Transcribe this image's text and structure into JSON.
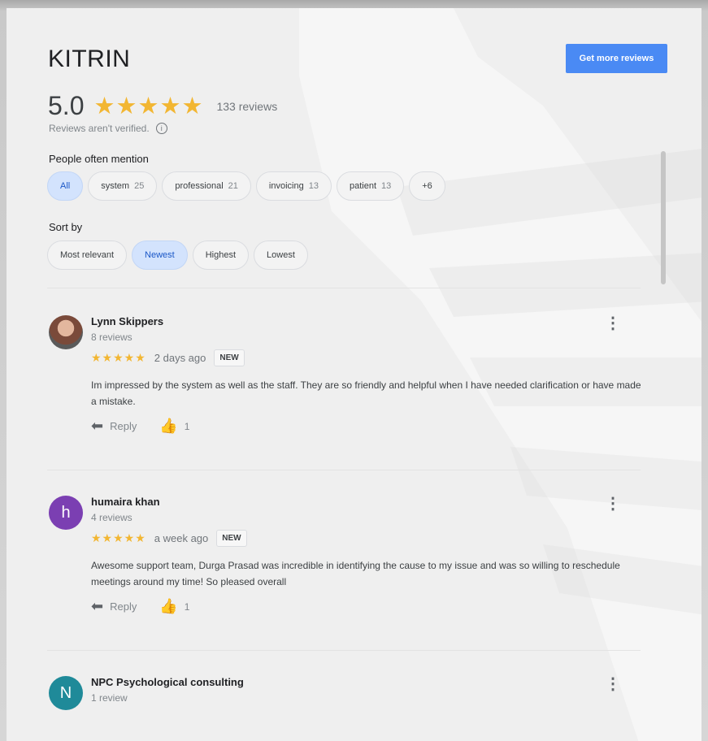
{
  "business": {
    "name": "KITRIN",
    "cta_label": "Get more reviews"
  },
  "summary": {
    "rating": "5.0",
    "stars": "★★★★★",
    "review_count": "133 reviews",
    "verification_note": "Reviews aren't verified.",
    "info_glyph": "i"
  },
  "mentions": {
    "title": "People often mention",
    "chips": [
      {
        "label": "All",
        "count": "",
        "selected": true
      },
      {
        "label": "system",
        "count": "25"
      },
      {
        "label": "professional",
        "count": "21"
      },
      {
        "label": "invoicing",
        "count": "13"
      },
      {
        "label": "patient",
        "count": "13"
      },
      {
        "label": "+6",
        "count": ""
      }
    ]
  },
  "sort": {
    "title": "Sort by",
    "options": [
      "Most relevant",
      "Newest",
      "Highest",
      "Lowest"
    ],
    "selected": "Newest"
  },
  "reviews": [
    {
      "name": "Lynn Skippers",
      "meta": "8 reviews",
      "avatar": "",
      "stars": "★★★★★",
      "time": "2 days ago",
      "badge": "NEW",
      "text": "Im impressed by the system as well as the staff. They are so friendly and helpful when I have needed clarification or have made a mistake.",
      "reply_label": "Reply",
      "likes": "1"
    },
    {
      "name": "humaira khan",
      "meta": "4 reviews",
      "avatar": "h",
      "avatar_color": "#7b3fb2",
      "stars": "★★★★★",
      "time": "a week ago",
      "badge": "NEW",
      "text": "Awesome support team, Durga Prasad was incredible in identifying the cause to my issue and was so willing to reschedule meetings around my time! So pleased overall",
      "reply_label": "Reply",
      "likes": "1"
    },
    {
      "name": "NPC Psychological consulting",
      "meta": "1 review",
      "avatar": "N",
      "avatar_color": "#1f8a99"
    }
  ],
  "icons": {
    "reply": "reply-arrow-icon",
    "like": "thumbs-up-icon",
    "more": "more-vert-icon"
  },
  "glyphs": {
    "reply": "⬅",
    "like": "👍",
    "more": "⋮"
  },
  "colors": {
    "accent": "#4a8af4",
    "star": "#f2b632",
    "chip_selected": "#d3e3fd"
  }
}
